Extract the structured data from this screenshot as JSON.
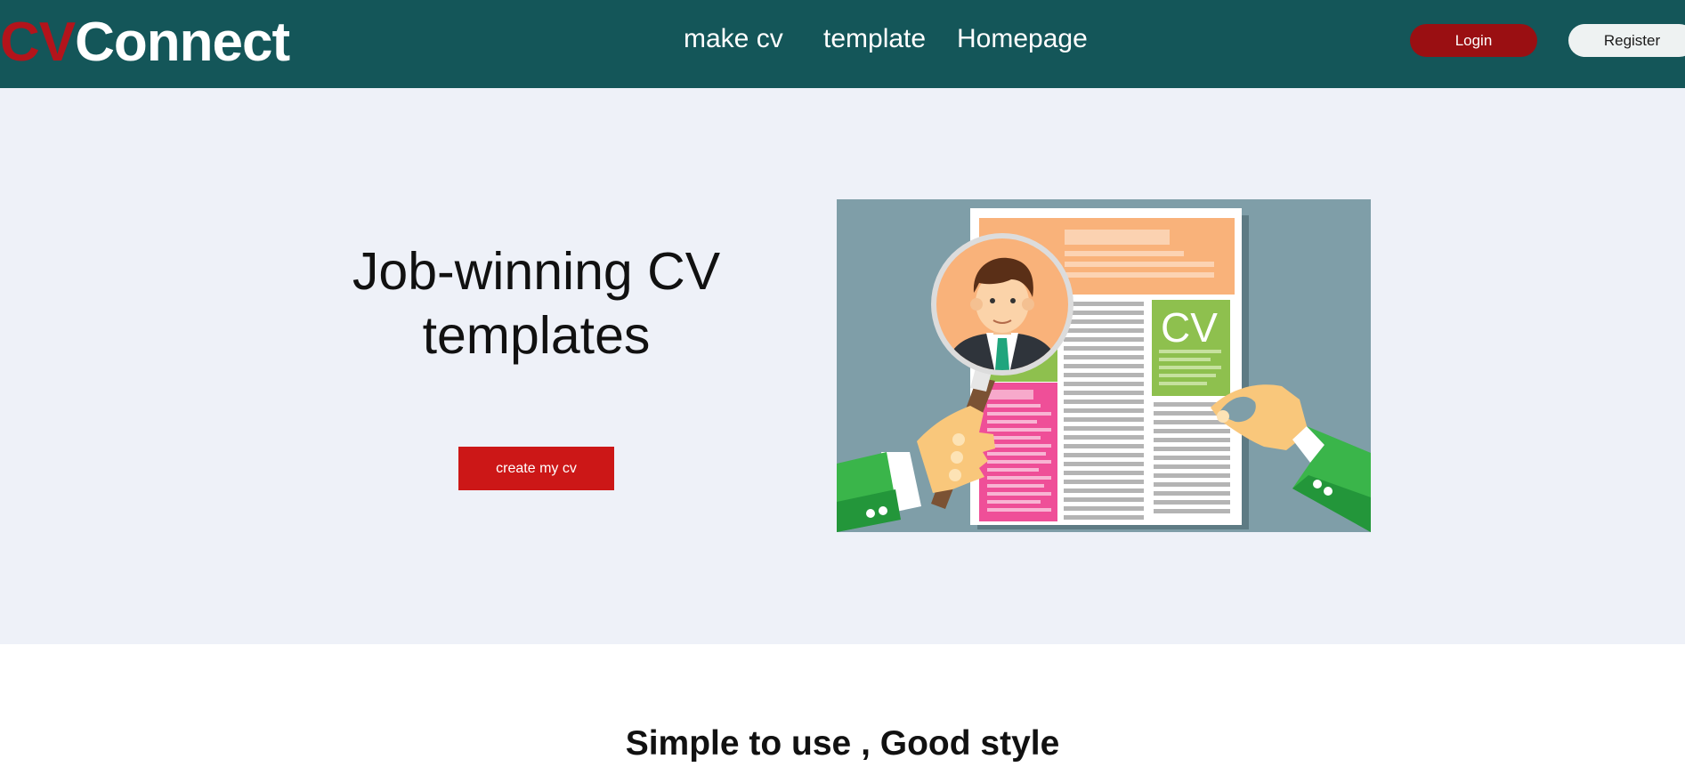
{
  "brand": {
    "part1": "CV",
    "part2": "Connect"
  },
  "nav": {
    "items": [
      "make cv",
      "template",
      "Homepage"
    ]
  },
  "auth": {
    "login": "Login",
    "register": "Register"
  },
  "hero": {
    "title": "Job-winning CV templates",
    "cta": "create my cv",
    "illustration_text": "CV"
  },
  "section": {
    "title": "Simple to use , Good style"
  },
  "colors": {
    "navbar": "#145659",
    "brand_accent": "#b3141b",
    "login_btn": "#9a0f12",
    "cta_btn": "#cc1717",
    "hero_bg": "#eef1f8"
  }
}
